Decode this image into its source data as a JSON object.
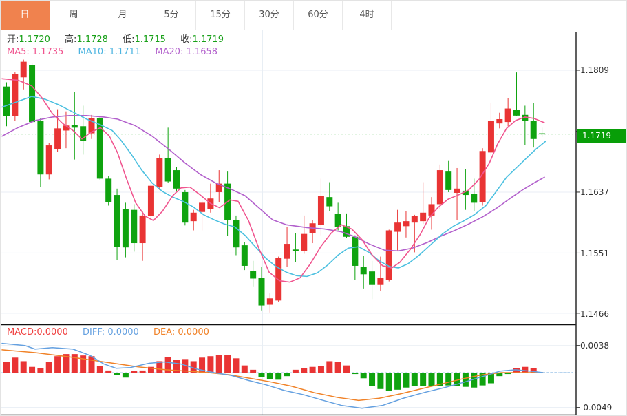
{
  "tabs": [
    {
      "label": "日",
      "active": true
    },
    {
      "label": "周",
      "active": false
    },
    {
      "label": "月",
      "active": false
    },
    {
      "label": "5分",
      "active": false
    },
    {
      "label": "15分",
      "active": false
    },
    {
      "label": "30分",
      "active": false
    },
    {
      "label": "60分",
      "active": false
    },
    {
      "label": "4时",
      "active": false
    }
  ],
  "ohlc_readout": [
    {
      "label": "开:",
      "value": "1.1720"
    },
    {
      "label": "高:",
      "value": "1.1728"
    },
    {
      "label": "低:",
      "value": "1.1715"
    },
    {
      "label": "收:",
      "value": "1.1719"
    }
  ],
  "ma_readout": [
    {
      "label": "MA5:",
      "value": "1.1735"
    },
    {
      "label": "MA10:",
      "value": "1.1711"
    },
    {
      "label": "MA20:",
      "value": "1.1658"
    }
  ],
  "macd_readout": [
    {
      "label": "MACD:",
      "value": "0.0000"
    },
    {
      "label": "DIFF:",
      "value": "0.0000"
    },
    {
      "label": "DEA:",
      "value": "0.0000"
    }
  ],
  "price_axis_labels": [
    "1.1809",
    "1.1637",
    "1.1551",
    "1.1466"
  ],
  "macd_axis_labels": [
    "0.0038",
    "-0.0049"
  ],
  "last_price_badge": "1.1719",
  "colors": {
    "up_red": "#e93434",
    "down_green": "#0fa30f",
    "ohlc_value_green": "#18a018",
    "ma5_pink": "#f0558f",
    "ma10_cyan": "#4cc0e0",
    "ma20_purple": "#b260cc",
    "diff_blue": "#64a0e0",
    "dea_orange": "#f08228",
    "macd_label_red": "#f04040",
    "active_tab_orange": "#f0824e",
    "badge_green": "#089e08",
    "dotted_line_green": "#15a315",
    "grid": "#e8eef4",
    "axis_dark": "#2b2b2b"
  },
  "chart_data": {
    "type": "candlestick",
    "title": "EUR/USD daily K-line with MA5/MA10/MA20 and MACD",
    "main_panel": {
      "ylim": [
        1.1451,
        1.1873
      ],
      "grid_price_levels": [
        1.1809,
        1.1723,
        1.1637,
        1.1551,
        1.1466
      ],
      "current_price_line": 1.1719,
      "candles_ohlc": [
        [
          1.1786,
          1.1792,
          1.173,
          1.1744
        ],
        [
          1.1744,
          1.1806,
          1.1738,
          1.1804
        ],
        [
          1.1799,
          1.1824,
          1.1782,
          1.1821
        ],
        [
          1.1816,
          1.1819,
          1.1734,
          1.1736
        ],
        [
          1.1738,
          1.1741,
          1.1644,
          1.1662
        ],
        [
          1.1662,
          1.1706,
          1.1655,
          1.1703
        ],
        [
          1.1698,
          1.1754,
          1.1694,
          1.1727
        ],
        [
          1.1724,
          1.1751,
          1.1699,
          1.1731
        ],
        [
          1.1732,
          1.1778,
          1.1683,
          1.1728
        ],
        [
          1.173,
          1.1759,
          1.169,
          1.1709
        ],
        [
          1.172,
          1.1746,
          1.1712,
          1.1741
        ],
        [
          1.1741,
          1.1744,
          1.1654,
          1.1656
        ],
        [
          1.1656,
          1.166,
          1.1618,
          1.1623
        ],
        [
          1.1633,
          1.1642,
          1.1541,
          1.156
        ],
        [
          1.1613,
          1.1622,
          1.1545,
          1.1559
        ],
        [
          1.1612,
          1.162,
          1.1553,
          1.1565
        ],
        [
          1.1565,
          1.161,
          1.154,
          1.1604
        ],
        [
          1.1603,
          1.165,
          1.1598,
          1.1646
        ],
        [
          1.1644,
          1.169,
          1.164,
          1.1685
        ],
        [
          1.1685,
          1.1728,
          1.165,
          1.1652
        ],
        [
          1.1668,
          1.1672,
          1.1638,
          1.1642
        ],
        [
          1.1637,
          1.164,
          1.159,
          1.1594
        ],
        [
          1.1596,
          1.1612,
          1.1583,
          1.1608
        ],
        [
          1.1609,
          1.1625,
          1.1583,
          1.1622
        ],
        [
          1.1613,
          1.1649,
          1.1608,
          1.1628
        ],
        [
          1.1637,
          1.1668,
          1.1623,
          1.1649
        ],
        [
          1.1649,
          1.1666,
          1.1575,
          1.1598
        ],
        [
          1.1598,
          1.1604,
          1.1548,
          1.1559
        ],
        [
          1.1562,
          1.1566,
          1.1527,
          1.1533
        ],
        [
          1.1526,
          1.154,
          1.1504,
          1.1515
        ],
        [
          1.1516,
          1.1531,
          1.147,
          1.1477
        ],
        [
          1.1478,
          1.1494,
          1.1467,
          1.1487
        ],
        [
          1.1484,
          1.1546,
          1.1482,
          1.1544
        ],
        [
          1.1543,
          1.1588,
          1.1531,
          1.1564
        ],
        [
          1.1556,
          1.1579,
          1.1538,
          1.1554
        ],
        [
          1.1554,
          1.1604,
          1.155,
          1.1578
        ],
        [
          1.1579,
          1.1598,
          1.1565,
          1.1593
        ],
        [
          1.1591,
          1.1656,
          1.1576,
          1.1632
        ],
        [
          1.163,
          1.1651,
          1.161,
          1.1617
        ],
        [
          1.1606,
          1.1622,
          1.1583,
          1.1588
        ],
        [
          1.1589,
          1.1607,
          1.1572,
          1.1574
        ],
        [
          1.1574,
          1.1576,
          1.1513,
          1.1533
        ],
        [
          1.1531,
          1.1547,
          1.1501,
          1.1521
        ],
        [
          1.1525,
          1.154,
          1.1486,
          1.1506
        ],
        [
          1.1506,
          1.1546,
          1.1498,
          1.1516
        ],
        [
          1.1513,
          1.1584,
          1.1511,
          1.1583
        ],
        [
          1.1581,
          1.1612,
          1.1555,
          1.1594
        ],
        [
          1.1589,
          1.161,
          1.1573,
          1.1596
        ],
        [
          1.1594,
          1.1605,
          1.1552,
          1.1603
        ],
        [
          1.1596,
          1.1651,
          1.1592,
          1.1608
        ],
        [
          1.1604,
          1.163,
          1.1584,
          1.162
        ],
        [
          1.162,
          1.1676,
          1.1613,
          1.1668
        ],
        [
          1.1666,
          1.1681,
          1.1637,
          1.164
        ],
        [
          1.1636,
          1.1671,
          1.1598,
          1.1642
        ],
        [
          1.1639,
          1.167,
          1.1612,
          1.1633
        ],
        [
          1.1635,
          1.1656,
          1.161,
          1.1622
        ],
        [
          1.1623,
          1.1699,
          1.1618,
          1.1695
        ],
        [
          1.1693,
          1.1763,
          1.1688,
          1.1738
        ],
        [
          1.1734,
          1.1749,
          1.1727,
          1.174
        ],
        [
          1.1736,
          1.177,
          1.173,
          1.1755
        ],
        [
          1.1753,
          1.1806,
          1.1744,
          1.1745
        ],
        [
          1.1746,
          1.1759,
          1.1704,
          1.1738
        ],
        [
          1.1738,
          1.1763,
          1.17,
          1.1712
        ],
        [
          1.172,
          1.1728,
          1.1715,
          1.1719
        ]
      ],
      "ma5_points": [
        [
          2,
          1.1797
        ],
        [
          25,
          1.1795
        ],
        [
          45,
          1.1787
        ],
        [
          60,
          1.177
        ],
        [
          75,
          1.1748
        ],
        [
          90,
          1.1734
        ],
        [
          105,
          1.1724
        ],
        [
          118,
          1.1712
        ],
        [
          132,
          1.1722
        ],
        [
          145,
          1.1728
        ],
        [
          158,
          1.1716
        ],
        [
          170,
          1.1692
        ],
        [
          182,
          1.1658
        ],
        [
          196,
          1.1622
        ],
        [
          210,
          1.1603
        ],
        [
          222,
          1.1597
        ],
        [
          235,
          1.161
        ],
        [
          250,
          1.1632
        ],
        [
          262,
          1.1643
        ],
        [
          275,
          1.1644
        ],
        [
          290,
          1.1633
        ],
        [
          305,
          1.1621
        ],
        [
          318,
          1.1615
        ],
        [
          333,
          1.1626
        ],
        [
          345,
          1.1624
        ],
        [
          360,
          1.1597
        ],
        [
          375,
          1.1558
        ],
        [
          390,
          1.1524
        ],
        [
          405,
          1.1512
        ],
        [
          420,
          1.151
        ],
        [
          435,
          1.1516
        ],
        [
          450,
          1.1536
        ],
        [
          465,
          1.156
        ],
        [
          480,
          1.1579
        ],
        [
          495,
          1.1591
        ],
        [
          510,
          1.1585
        ],
        [
          525,
          1.157
        ],
        [
          540,
          1.1548
        ],
        [
          555,
          1.1533
        ],
        [
          568,
          1.153
        ],
        [
          580,
          1.1538
        ],
        [
          595,
          1.1556
        ],
        [
          610,
          1.1578
        ],
        [
          622,
          1.16
        ],
        [
          635,
          1.1615
        ],
        [
          650,
          1.1627
        ],
        [
          665,
          1.1633
        ],
        [
          680,
          1.164
        ],
        [
          695,
          1.1655
        ],
        [
          710,
          1.1678
        ],
        [
          722,
          1.1705
        ],
        [
          735,
          1.1727
        ],
        [
          748,
          1.1738
        ],
        [
          762,
          1.1743
        ],
        [
          775,
          1.1741
        ],
        [
          790,
          1.1735
        ]
      ],
      "ma10_points": [
        [
          2,
          1.1757
        ],
        [
          25,
          1.1765
        ],
        [
          45,
          1.1772
        ],
        [
          65,
          1.1768
        ],
        [
          85,
          1.176
        ],
        [
          105,
          1.175
        ],
        [
          125,
          1.174
        ],
        [
          145,
          1.1732
        ],
        [
          162,
          1.1724
        ],
        [
          175,
          1.171
        ],
        [
          190,
          1.169
        ],
        [
          205,
          1.1668
        ],
        [
          220,
          1.165
        ],
        [
          235,
          1.1638
        ],
        [
          250,
          1.163
        ],
        [
          265,
          1.1624
        ],
        [
          280,
          1.1616
        ],
        [
          295,
          1.1605
        ],
        [
          310,
          1.1598
        ],
        [
          325,
          1.1592
        ],
        [
          340,
          1.1588
        ],
        [
          355,
          1.1576
        ],
        [
          370,
          1.156
        ],
        [
          385,
          1.1544
        ],
        [
          400,
          1.1532
        ],
        [
          415,
          1.1524
        ],
        [
          430,
          1.1519
        ],
        [
          445,
          1.1518
        ],
        [
          460,
          1.1523
        ],
        [
          475,
          1.1534
        ],
        [
          490,
          1.1548
        ],
        [
          505,
          1.1558
        ],
        [
          520,
          1.156
        ],
        [
          535,
          1.1552
        ],
        [
          550,
          1.154
        ],
        [
          565,
          1.1532
        ],
        [
          578,
          1.153
        ],
        [
          592,
          1.1536
        ],
        [
          608,
          1.1548
        ],
        [
          625,
          1.1563
        ],
        [
          642,
          1.1578
        ],
        [
          658,
          1.1589
        ],
        [
          672,
          1.1596
        ],
        [
          688,
          1.1605
        ],
        [
          705,
          1.1618
        ],
        [
          720,
          1.1638
        ],
        [
          735,
          1.1658
        ],
        [
          750,
          1.1672
        ],
        [
          765,
          1.1686
        ],
        [
          778,
          1.1698
        ],
        [
          792,
          1.1709
        ]
      ],
      "ma20_points": [
        [
          2,
          1.1716
        ],
        [
          25,
          1.1728
        ],
        [
          50,
          1.1738
        ],
        [
          75,
          1.1743
        ],
        [
          100,
          1.1745
        ],
        [
          125,
          1.1745
        ],
        [
          150,
          1.1743
        ],
        [
          170,
          1.174
        ],
        [
          195,
          1.1731
        ],
        [
          220,
          1.1716
        ],
        [
          245,
          1.1697
        ],
        [
          268,
          1.1678
        ],
        [
          290,
          1.1662
        ],
        [
          312,
          1.165
        ],
        [
          335,
          1.1641
        ],
        [
          355,
          1.1632
        ],
        [
          375,
          1.1615
        ],
        [
          395,
          1.1598
        ],
        [
          415,
          1.1591
        ],
        [
          445,
          1.1587
        ],
        [
          470,
          1.1585
        ],
        [
          495,
          1.1581
        ],
        [
          515,
          1.1574
        ],
        [
          535,
          1.1564
        ],
        [
          558,
          1.1555
        ],
        [
          578,
          1.1554
        ],
        [
          598,
          1.1558
        ],
        [
          620,
          1.1566
        ],
        [
          640,
          1.1575
        ],
        [
          660,
          1.1583
        ],
        [
          680,
          1.1592
        ],
        [
          700,
          1.1602
        ],
        [
          720,
          1.1614
        ],
        [
          740,
          1.1628
        ],
        [
          758,
          1.164
        ],
        [
          775,
          1.165
        ],
        [
          790,
          1.1658
        ]
      ]
    },
    "macd_panel": {
      "ylim": [
        -0.0049,
        0.0038
      ],
      "grid_levels": [
        0.0038,
        -0.0049
      ],
      "histogram": [
        0.0015,
        0.0021,
        0.0016,
        0.0008,
        0.0006,
        0.0015,
        0.0023,
        0.0026,
        0.0026,
        0.0024,
        0.0023,
        0.0009,
        0.0003,
        -0.0003,
        -0.0007,
        0.0002,
        0.0003,
        0.0008,
        0.0016,
        0.0022,
        0.0018,
        0.0019,
        0.0016,
        0.0021,
        0.0023,
        0.0025,
        0.0025,
        0.002,
        0.001,
        0.0004,
        -0.0006,
        -0.0009,
        -0.001,
        -0.0005,
        0.0004,
        0.0006,
        0.0008,
        0.0009,
        0.0016,
        0.0015,
        0.001,
        -0.0002,
        -0.0008,
        -0.0019,
        -0.0023,
        -0.0026,
        -0.0024,
        -0.0021,
        -0.0019,
        -0.0019,
        -0.0019,
        -0.0019,
        -0.0018,
        -0.0019,
        -0.002,
        -0.0021,
        -0.0018,
        -0.0015,
        -0.0005,
        -0.0002,
        0.0006,
        0.0008,
        0.0006,
        0.0
      ],
      "diff_points": [
        [
          2,
          0.0041
        ],
        [
          35,
          0.0038
        ],
        [
          50,
          0.0033
        ],
        [
          75,
          0.0035
        ],
        [
          105,
          0.0033
        ],
        [
          130,
          0.0024
        ],
        [
          150,
          0.0012
        ],
        [
          168,
          0.0006
        ],
        [
          188,
          0.0007
        ],
        [
          215,
          0.0013
        ],
        [
          238,
          0.0015
        ],
        [
          262,
          0.0012
        ],
        [
          285,
          0.0005
        ],
        [
          310,
          0.0
        ],
        [
          335,
          -0.0004
        ],
        [
          360,
          -0.0011
        ],
        [
          385,
          -0.0017
        ],
        [
          412,
          -0.0025
        ],
        [
          440,
          -0.0031
        ],
        [
          465,
          -0.0038
        ],
        [
          495,
          -0.0046
        ],
        [
          525,
          -0.005
        ],
        [
          555,
          -0.0046
        ],
        [
          585,
          -0.0036
        ],
        [
          615,
          -0.0028
        ],
        [
          645,
          -0.0021
        ],
        [
          675,
          -0.0013
        ],
        [
          702,
          -0.0005
        ],
        [
          725,
          0.0002
        ],
        [
          748,
          0.0004
        ],
        [
          770,
          0.0002
        ],
        [
          788,
          0.0
        ]
      ],
      "dea_points": [
        [
          2,
          0.0032
        ],
        [
          50,
          0.0028
        ],
        [
          100,
          0.0022
        ],
        [
          150,
          0.0015
        ],
        [
          200,
          0.0008
        ],
        [
          240,
          0.0004
        ],
        [
          272,
          0.0002
        ],
        [
          302,
          0.0
        ],
        [
          332,
          -0.0003
        ],
        [
          362,
          -0.0008
        ],
        [
          392,
          -0.0013
        ],
        [
          422,
          -0.0019
        ],
        [
          455,
          -0.0028
        ],
        [
          490,
          -0.0035
        ],
        [
          520,
          -0.0039
        ],
        [
          550,
          -0.0036
        ],
        [
          580,
          -0.003
        ],
        [
          610,
          -0.0023
        ],
        [
          640,
          -0.0016
        ],
        [
          670,
          -0.0009
        ],
        [
          700,
          -0.0003
        ],
        [
          728,
          0.0
        ],
        [
          788,
          0.0
        ]
      ]
    }
  }
}
